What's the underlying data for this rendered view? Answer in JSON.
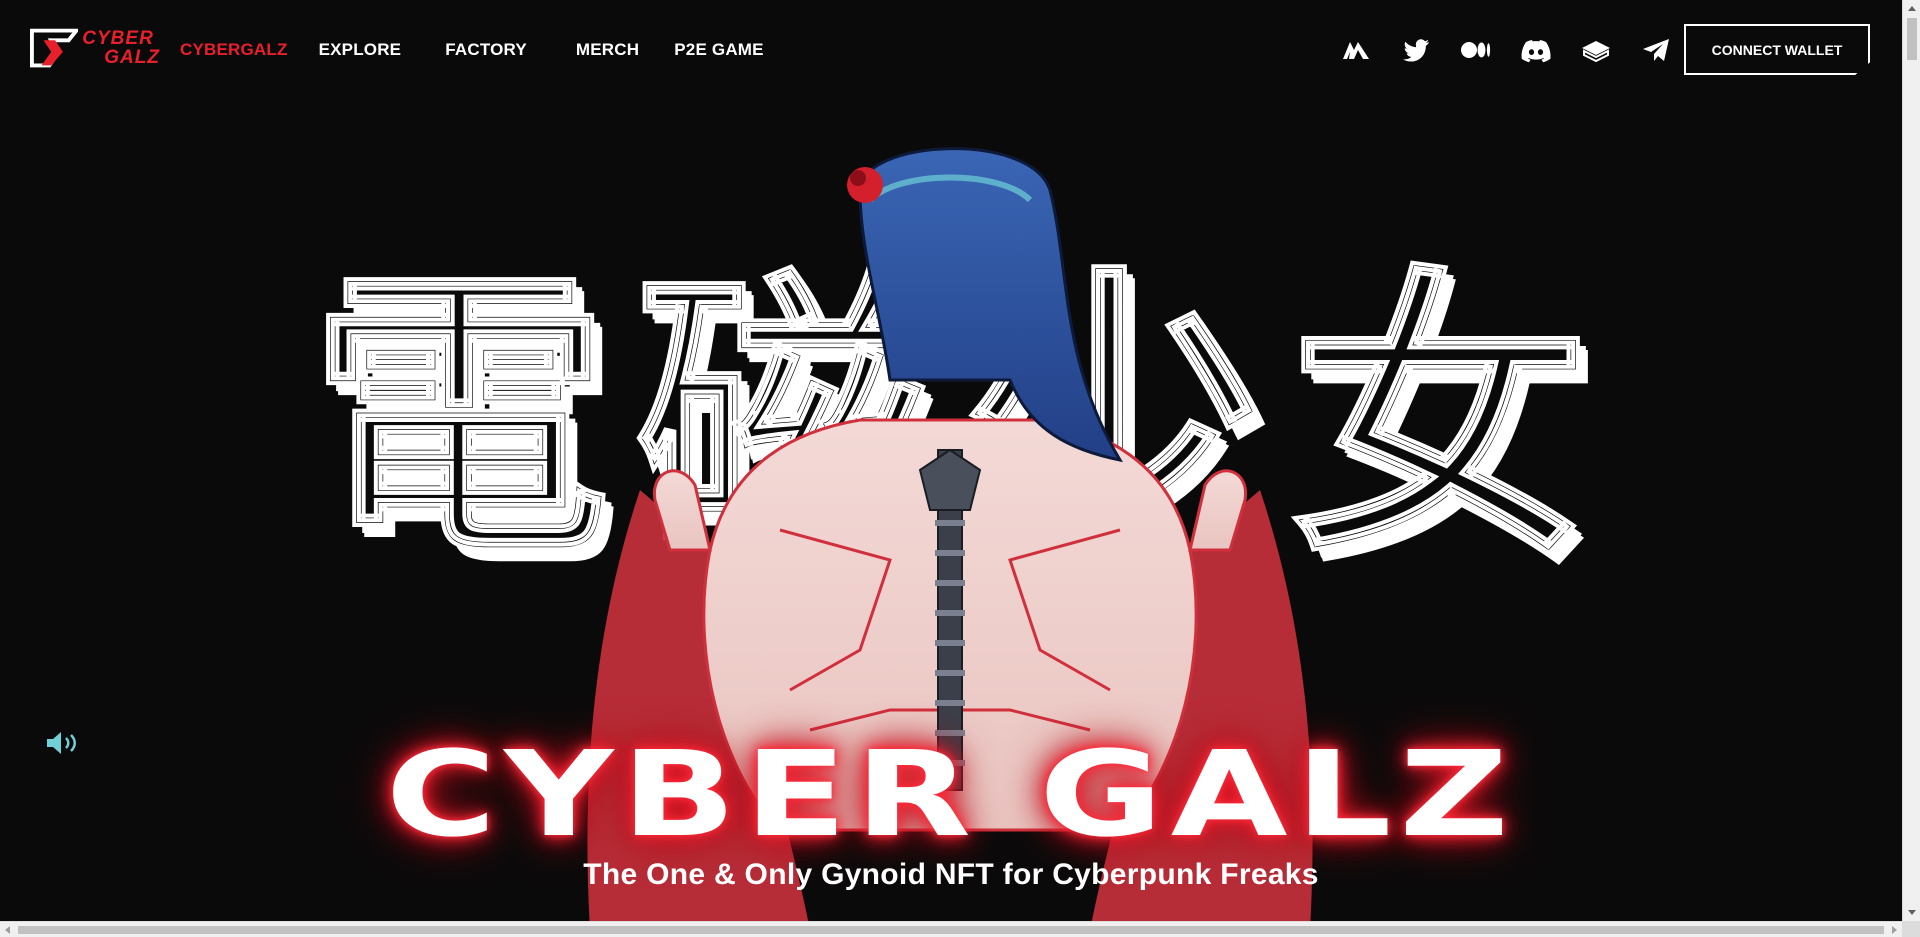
{
  "brand": {
    "logo_line1": "CYBER",
    "logo_line2": "GALZ",
    "accent_color": "#e8202c"
  },
  "nav": {
    "items": [
      {
        "label": "CYBERGALZ",
        "active": true
      },
      {
        "label": "EXPLORE",
        "active": false
      },
      {
        "label": "FACTORY",
        "active": false
      },
      {
        "label": "MERCH",
        "active": false
      },
      {
        "label": "P2E GAME",
        "active": false
      }
    ]
  },
  "socials": [
    {
      "icon": "opensea-mountains-icon"
    },
    {
      "icon": "twitter-icon"
    },
    {
      "icon": "medium-icon"
    },
    {
      "icon": "discord-icon"
    },
    {
      "icon": "book-icon"
    },
    {
      "icon": "telegram-icon"
    }
  ],
  "wallet": {
    "label": "CONNECT WALLET"
  },
  "hero": {
    "kanji": [
      "電",
      "磁",
      "少",
      "女"
    ],
    "title": "CYBER GALZ",
    "subtitle": "The One & Only Gynoid NFT for Cyberpunk Freaks"
  },
  "sound": {
    "icon": "speaker-icon"
  }
}
